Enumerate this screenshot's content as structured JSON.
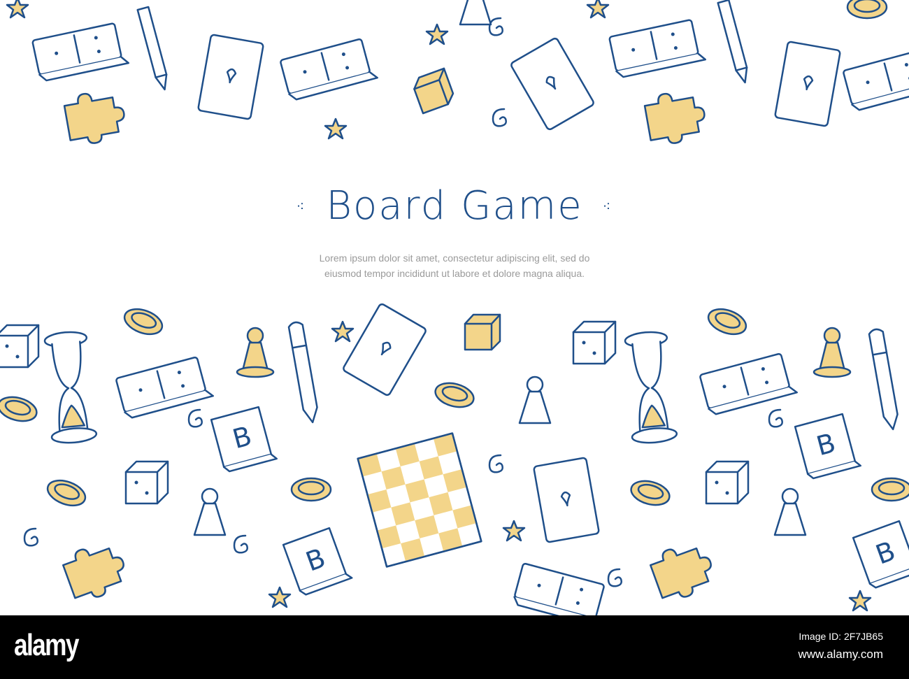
{
  "banner": {
    "title": "Board Game",
    "title_ornament_left": "⁖",
    "title_ornament_right": "⁖",
    "subtitle_line1": "Lorem ipsum dolor sit amet, consectetur adipiscing elit, sed do",
    "subtitle_line2": "eiusmod tempor incididunt ut labore et dolore magna aliqua."
  },
  "watermark": {
    "logo": "alamy",
    "image_id": "Image ID: 2F7JB65",
    "url": "www.alamy.com"
  },
  "colors": {
    "ink": "#1f4f8a",
    "fill": "#f3d58a",
    "text": "#9a9a9a"
  },
  "icons": [
    "domino-icon",
    "playing-card-icon",
    "dice-icon",
    "star-icon",
    "coin-icon",
    "pawn-icon",
    "puzzle-piece-icon",
    "pencil-icon",
    "hourglass-icon",
    "spiral-icon",
    "letter-tile-icon",
    "chessboard-icon",
    "pen-icon"
  ]
}
